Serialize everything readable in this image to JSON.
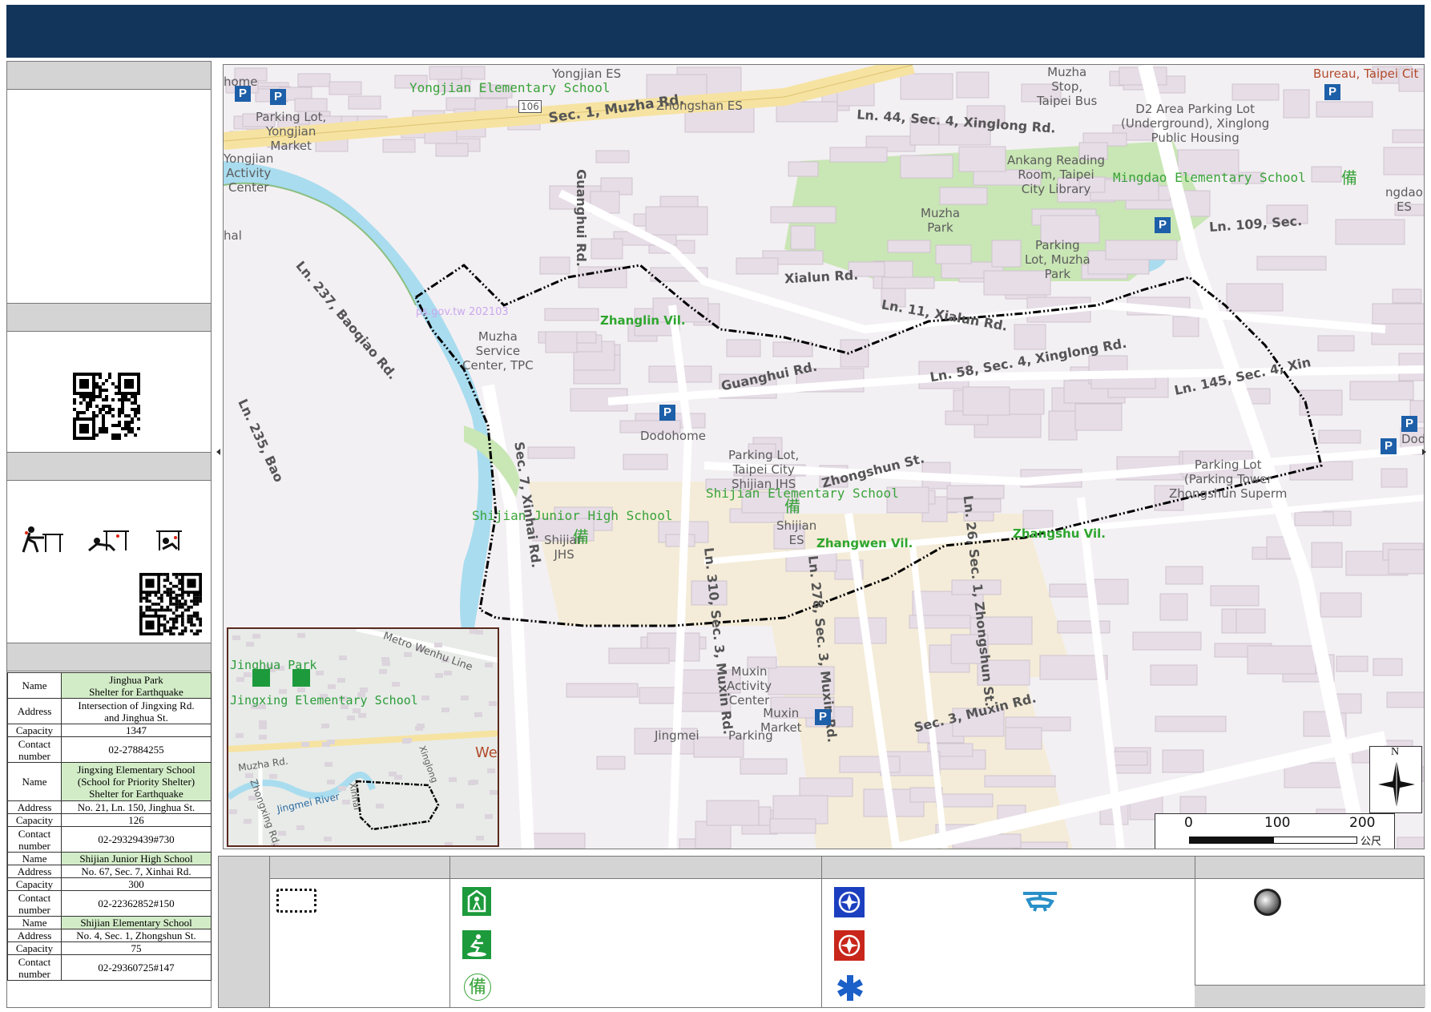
{
  "shelters": [
    {
      "name_label": "Name",
      "name": "Jinghua Park\nShelter for Earthquake",
      "addr_label": "Address",
      "addr": "Intersection of Jingxing Rd.\nand Jinghua St.",
      "cap_label": "Capacity",
      "cap": "1347",
      "contact_label": "Contact\nnumber",
      "contact": "02-27884255"
    },
    {
      "name_label": "Name",
      "name": "Jingxing Elementary School\n(School for Priority Shelter)\nShelter for Earthquake",
      "addr_label": "Address",
      "addr": "No. 21, Ln. 150, Jinghua St.",
      "cap_label": "Capacity",
      "cap": "126",
      "contact_label": "Contact\nnumber",
      "contact": "02-29329439#730"
    },
    {
      "name_label": "Name",
      "name": "Shijian Junior High School",
      "addr_label": "Address",
      "addr": "No. 67, Sec. 7, Xinhai Rd.",
      "cap_label": "Capacity",
      "cap": "300",
      "contact_label": "Contact\nnumber",
      "contact": "02-22362852#150"
    },
    {
      "name_label": "Name",
      "name": "Shijian Elementary School",
      "addr_label": "Address",
      "addr": "No. 4, Sec. 1, Zhongshun St.",
      "cap_label": "Capacity",
      "cap": "75",
      "contact_label": "Contact\nnumber",
      "contact": "02-29360725#147"
    }
  ],
  "map_labels": {
    "yongjian_es": "Yongjian Elementary School",
    "yongjian_es_short": "Yongjian ES",
    "muzha_rd": "Sec. 1, Muzha Rd.",
    "route_106": "106",
    "zhongshan_es": "Zhongshan ES",
    "parking_yongjian": "Parking Lot,\nYongjian\nMarket",
    "yongjian_activity": "Yongjian\nActivity\nCenter",
    "home": "home",
    "muzha_stop": "Muzha\nStop,\nTaipei Bus",
    "bureau": "Bureau, Taipei Cit",
    "d2_parking": "D2 Area Parking Lot\n(Underground), Xinglong\nPublic Housing",
    "xinglong_44": "Ln. 44, Sec. 4, Xinglong Rd.",
    "ankang": "Ankang Reading\nRoom, Taipei\nCity Library",
    "mingdao": "Mingdao Elementary School",
    "mingdao_es": "ngdao\nES",
    "guanghui_vert": "Guanghui Rd.",
    "muzha_park": "Muzha\nPark",
    "parking_muzha_park": "Parking\nLot, Muzha\nPark",
    "ln109": "Ln. 109, Sec.",
    "xialun": "Xialun Rd.",
    "ln11": "Ln. 11, Xialun Rd.",
    "baoqiao": "Ln. 237, Baoqiao Rd.",
    "muzha_service": "Muzha\nService\nCenter, TPC",
    "zhanglin": "Zhanglin Vil.",
    "ln58": "Ln. 58, Sec. 4, Xinglong Rd.",
    "ln145": "Ln. 145, Sec. 4, Xin",
    "guanghui_rd": "Guanghui Rd.",
    "ln235": "Ln. 235, Bao",
    "dodohome": "Dodohome",
    "dodo_right": "Dodo",
    "parking_shijian": "Parking Lot,\nTaipei City\nShijian JHS",
    "shijian_es": "Shijian Elementary School",
    "zhongshun": "Zhongshun St.",
    "parking_tower": "Parking Lot\n(Parking Tower\nZhongshun Superm",
    "sec7_xinhai": "Sec. 7, Xinhai Rd.",
    "shijian_jhs": "Shijian Junior High School",
    "shijian_jhs_short": "Shijian\nJHS",
    "shijian_es_short": "Shijian\nES",
    "zhangwen": "Zhangwen Vil.",
    "zhangshu": "Zhangshu Vil.",
    "ln26": "Ln. 26, Sec. 1, Zhongshun St.",
    "ln310": "Ln. 310, Sec. 3, Muxin Rd.",
    "ln278": "Ln. 278, Sec. 3, Muxin Rd.",
    "muxin_activity": "Muxin\nActivity\nCenter",
    "muxin_market": "Muxin\nMarket",
    "muxin_rd": "Sec. 3, Muxin Rd.",
    "jingmei": "Jingmei",
    "parking_bottom": "Parking",
    "hal": "hal",
    "watermark": "ps.gov.tw 202103"
  },
  "inset": {
    "jinghua_park": "Jinghua Park",
    "jingxing_es": "Jingxing Elementary School",
    "wenhu": "Metro Wenhu Line",
    "muzha_rd": "Muzha Rd.",
    "zhongxing": "Zhongxing Rd.",
    "jingmei_river": "Jingmei River",
    "we": "We",
    "xinhai": "Xinhai",
    "xinglong": "Xinglong"
  },
  "scale": {
    "s0": "0",
    "s1": "100",
    "s2": "200",
    "unit": "公尺"
  },
  "north": "N",
  "parking_symbol": "P",
  "reserve_glyph": "備",
  "colors": {
    "header": "#12355b",
    "water": "#a9dcef",
    "park": "#c9e6b5",
    "block": "#e6dde6",
    "boundary": "#000000"
  }
}
